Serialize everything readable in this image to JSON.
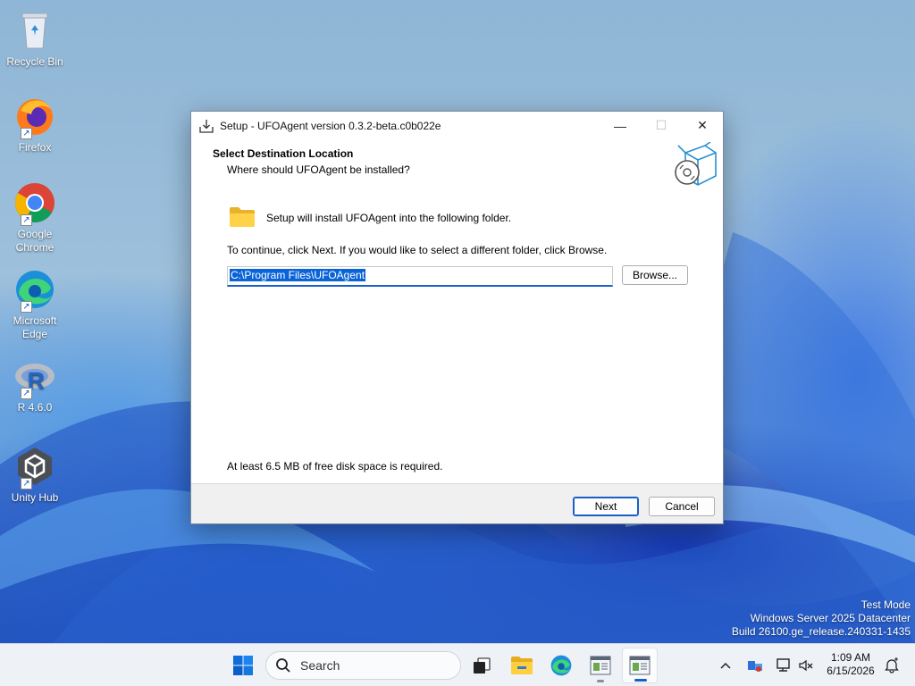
{
  "desktop": {
    "icons": [
      {
        "label": "Recycle Bin",
        "icon": "recycle-bin-icon"
      },
      {
        "label": "Firefox",
        "icon": "firefox-icon"
      },
      {
        "label": "Google Chrome",
        "icon": "chrome-icon"
      },
      {
        "label": "Microsoft Edge",
        "icon": "edge-icon"
      },
      {
        "label": "R 4.6.0",
        "icon": "r-icon"
      },
      {
        "label": "Unity Hub",
        "icon": "unity-hub-icon"
      }
    ]
  },
  "window": {
    "title": "Setup - UFOAgent version 0.3.2-beta.c0b022e",
    "controls": {
      "minimize": "—",
      "maximize": "☐",
      "close": "✕"
    },
    "header": {
      "title": "Select Destination Location",
      "subtitle": "Where should UFOAgent be installed?"
    },
    "body": {
      "install_text": "Setup will install UFOAgent into the following folder.",
      "continue_text": "To continue, click Next. If you would like to select a different folder, click Browse.",
      "path_value": "C:\\Program Files\\UFOAgent",
      "browse_label": "Browse...",
      "disk_text": "At least 6.5 MB of free disk space is required."
    },
    "footer": {
      "next_label": "Next",
      "cancel_label": "Cancel"
    }
  },
  "watermark": {
    "line1": "Test Mode",
    "line2": "Windows Server 2025 Datacenter",
    "line3": "Build 26100.ge_release.240331-1435"
  },
  "taskbar": {
    "search_placeholder": "Search",
    "pinned": [
      "start-icon",
      "task-view-icon",
      "file-explorer-icon",
      "edge-icon",
      "setup-app-icon",
      "setup-app-active-icon"
    ],
    "clock": {
      "time": "1:09 AM",
      "date": "6/15/2026"
    }
  },
  "colors": {
    "accent": "#1a5fc8",
    "taskbar_bg": "#eef1f6",
    "footer_bg": "#f0f0f0"
  }
}
